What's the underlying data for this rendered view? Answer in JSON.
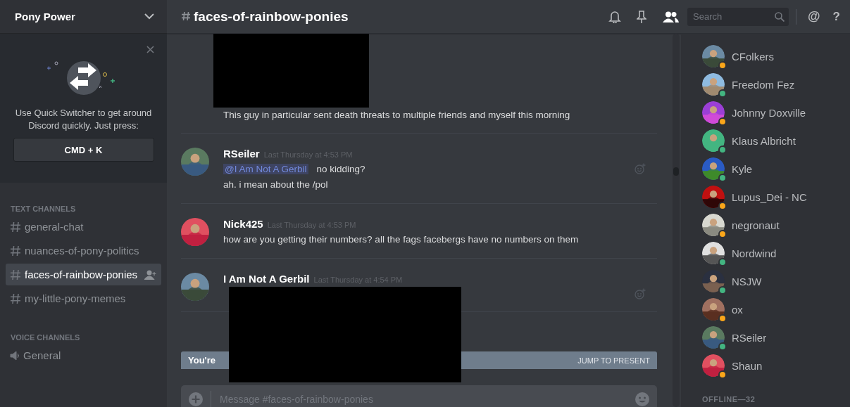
{
  "server": {
    "name": "Pony Power"
  },
  "quick_switcher": {
    "text": "Use Quick Switcher to get around Discord quickly. Just press:",
    "shortcut": "CMD + K"
  },
  "channel_groups": [
    {
      "title": "TEXT CHANNELS",
      "kind": "text",
      "channels": [
        {
          "name": "general-chat",
          "selected": false
        },
        {
          "name": "nuances-of-pony-politics",
          "selected": false
        },
        {
          "name": "faces-of-rainbow-ponies",
          "selected": true
        },
        {
          "name": "my-little-pony-memes",
          "selected": false
        }
      ]
    },
    {
      "title": "VOICE CHANNELS",
      "kind": "voice",
      "channels": [
        {
          "name": "General",
          "selected": false
        }
      ]
    }
  ],
  "header": {
    "channel": "faces-of-rainbow-ponies",
    "search_placeholder": "Search",
    "mention_label": "@",
    "help_label": "?"
  },
  "messages": [
    {
      "redacted": true,
      "reaction_button": false,
      "lines": [
        "This guy in particular sent death threats to multiple friends and myself this morning"
      ]
    },
    {
      "author": "RSeiler",
      "time": "Last Thursday at 4:53 PM",
      "redacted": false,
      "reaction_button": true,
      "mention": "@I Am Not A Gerbil",
      "lines": [
        "no kidding?",
        "ah. i mean about the /pol"
      ]
    },
    {
      "author": "Nick425",
      "time": "Last Thursday at 4:53 PM",
      "redacted": false,
      "reaction_button": false,
      "lines": [
        "how are you getting their numbers? all the fags facebergs have no numbers on them"
      ]
    },
    {
      "author": "I Am Not A Gerbil",
      "time": "Last Thursday at 4:54 PM",
      "redacted": true,
      "reaction_button": true
    }
  ],
  "history_bar": {
    "text": "You're",
    "action": "JUMP TO PRESENT"
  },
  "composer": {
    "placeholder": "Message #faces-of-rainbow-ponies"
  },
  "members": [
    {
      "name": "CFolkers",
      "color": "#faa61a"
    },
    {
      "name": "Freedom Fez",
      "color": "#43b581"
    },
    {
      "name": "Johnny Doxville",
      "color": "#faa61a"
    },
    {
      "name": "Klaus Albricht",
      "color": "#43b581"
    },
    {
      "name": "Kyle",
      "color": "#43b581"
    },
    {
      "name": "Lupus_Dei - NC",
      "color": "#faa61a"
    },
    {
      "name": "negronaut",
      "color": "#faa61a"
    },
    {
      "name": "Nordwind",
      "color": "#43b581"
    },
    {
      "name": "NSJW",
      "color": "#43b581"
    },
    {
      "name": "ox",
      "color": "#faa61a"
    },
    {
      "name": "RSeiler",
      "color": "#43b581"
    },
    {
      "name": "Shaun",
      "color": "#faa61a"
    }
  ],
  "offline_header": "OFFLINE—32"
}
